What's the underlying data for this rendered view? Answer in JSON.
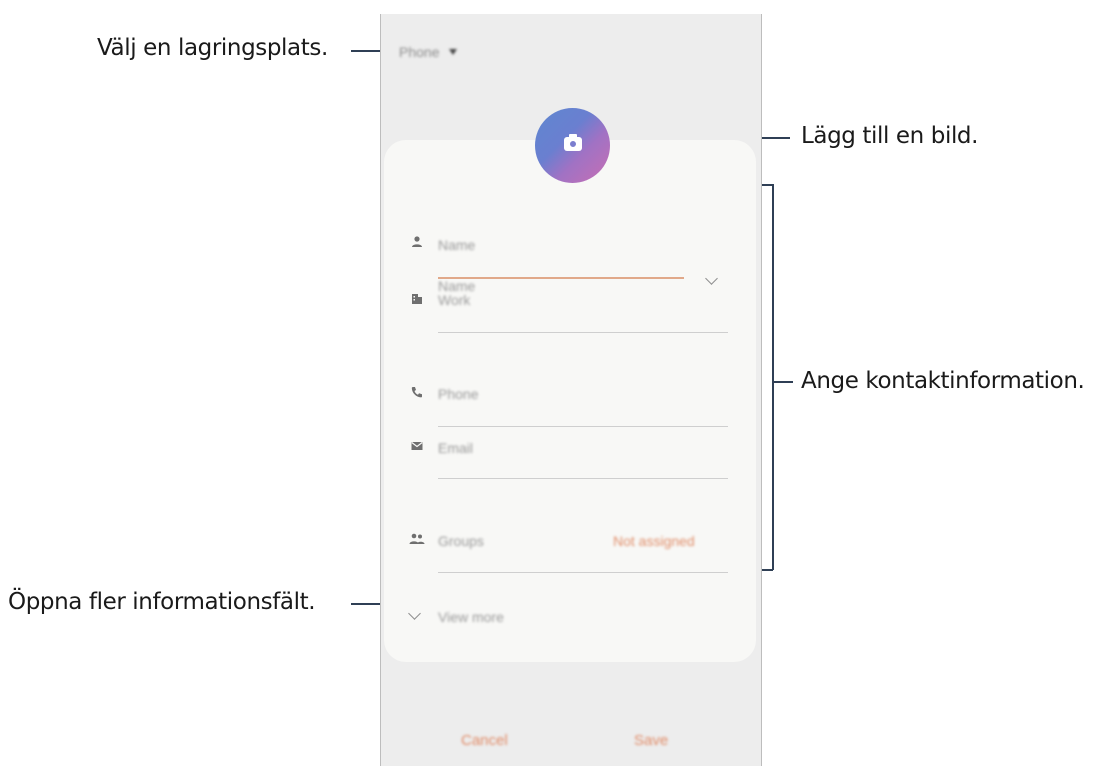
{
  "callouts": {
    "storage": "Välj en lagringsplats.",
    "photo": "Lägg till en bild.",
    "contact_info": "Ange kontaktinformation.",
    "more_fields": "Öppna fler informationsfält."
  },
  "phone": {
    "storage_label": "Phone",
    "fields": {
      "name_header": "Name",
      "name_input": "Name",
      "work": "Work",
      "phone": "Phone",
      "email": "Email",
      "groups": "Groups",
      "groups_value": "Not assigned"
    },
    "view_more": "View more",
    "buttons": {
      "cancel": "Cancel",
      "save": "Save"
    }
  },
  "icons": {
    "storage_dropdown": "caret-down-icon",
    "photo": "camera-icon",
    "name": "person-icon",
    "work": "building-icon",
    "phone": "phone-icon",
    "email": "envelope-icon",
    "groups": "people-icon",
    "name_expand": "chevron-down-icon",
    "view_more": "chevron-down-icon"
  },
  "colors": {
    "accent": "#e08a66",
    "avatar_start": "#5f87cf",
    "avatar_end": "#c86fb3",
    "callout_line": "#2f3f55"
  }
}
